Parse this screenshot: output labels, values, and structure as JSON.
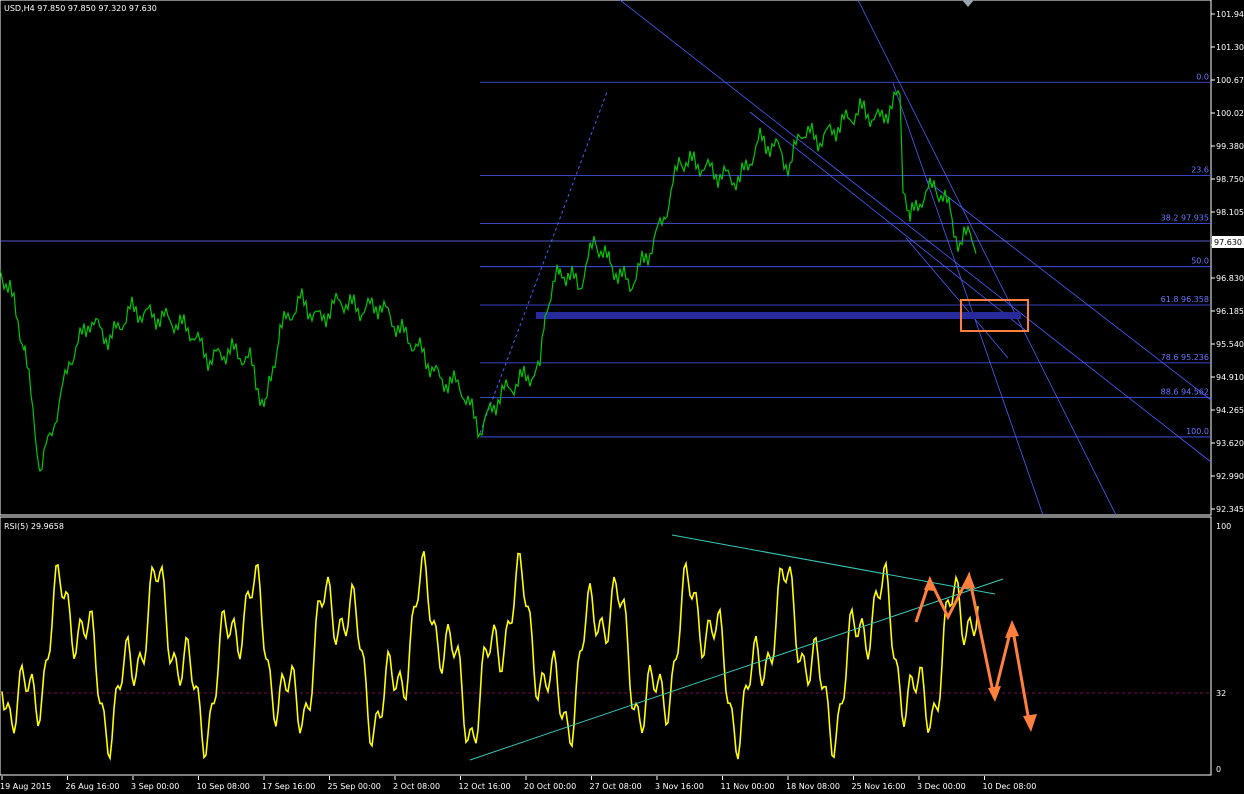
{
  "main_chart": {
    "header": "USD,H4  97.850 97.850 97.320 97.630",
    "price_axis": [
      "101.940",
      "101.305",
      "100.675",
      "100.025",
      "99.380",
      "98.750",
      "98.105",
      "97.460",
      "96.830",
      "96.185",
      "95.540",
      "94.910",
      "94.265",
      "93.620",
      "92.990",
      "92.345"
    ],
    "current_price": "97.630",
    "fib_levels": [
      {
        "label": "0.0",
        "price": 100.675
      },
      {
        "label": "23.6",
        "price": 98.87
      },
      {
        "label": "38.2 97.935",
        "price": 97.935
      },
      {
        "label": "50.0",
        "price": 97.1
      },
      {
        "label": "61.8 96.358",
        "price": 96.358
      },
      {
        "label": "78.6 95.236",
        "price": 95.236
      },
      {
        "label": "88.6 94.562",
        "price": 94.562
      },
      {
        "label": "100.0",
        "price": 93.8
      }
    ],
    "colors": {
      "candles": "#00c800",
      "lines": "#4a5bff",
      "fib": "#4a5bff",
      "zone": "#262a9a",
      "highlight_box": "#ff7f3f",
      "price_line": "#6a74ff"
    }
  },
  "indicator": {
    "header": "RSI(5) 29.9658",
    "axis": [
      "100",
      "32",
      "0"
    ],
    "level": 32,
    "colors": {
      "rsi": "#ffff00",
      "trend": "#36c9b9",
      "arrows": "#ff7f3f",
      "level_line": "#a01070"
    }
  },
  "time_axis": [
    "19 Aug 2015",
    "26 Aug 16:00",
    "3 Sep 00:00",
    "10 Sep 08:00",
    "17 Sep 16:00",
    "25 Sep 00:00",
    "2 Oct 08:00",
    "12 Oct 16:00",
    "20 Oct 00:00",
    "27 Oct 08:00",
    "3 Nov 16:00",
    "11 Nov 00:00",
    "18 Nov 08:00",
    "25 Nov 16:00",
    "3 Dec 00:00",
    "10 Dec 08:00"
  ]
}
